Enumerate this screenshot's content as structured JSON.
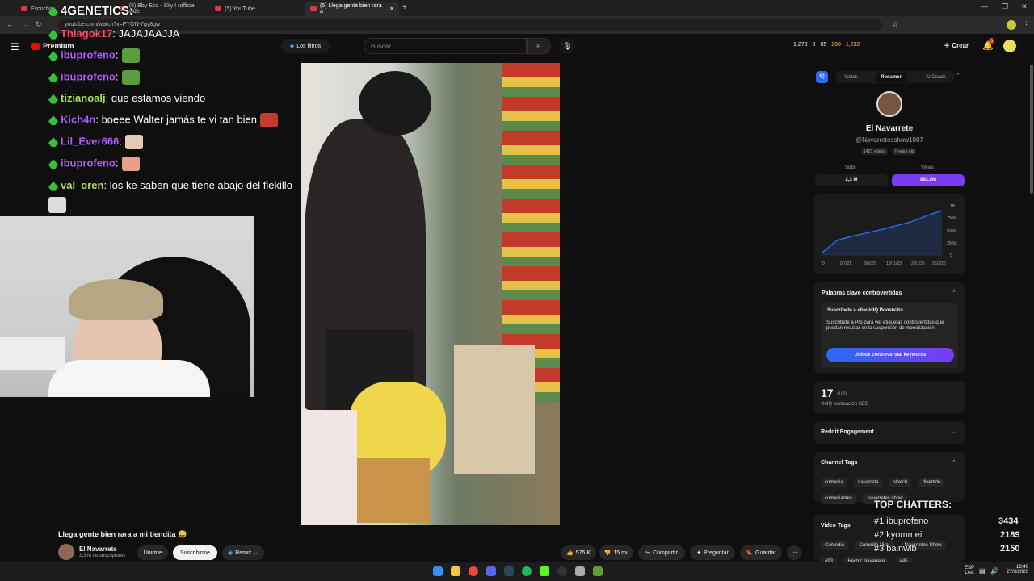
{
  "browser": {
    "tabs": [
      {
        "label": "Escucha"
      },
      {
        "label": "(5) Bby Eco - Sky I (official vide"
      },
      {
        "label": "(5) YouTube"
      },
      {
        "label": "(5) Llega gente bien rara a"
      }
    ],
    "url": "youtube.com/watch?v=PYON-7gy8gw"
  },
  "yt": {
    "logo": "Premium",
    "filters_label": "Los filtros",
    "search_placeholder": "Buscar",
    "stats": [
      "1,273",
      "0",
      "65",
      "260",
      "1,232"
    ],
    "create_label": "Crear",
    "notif_count": "5"
  },
  "chat": [
    {
      "user": "Thiagok17",
      "msg": ": JAJAJAAJJA",
      "color": "#ff4a6e"
    },
    {
      "user": "ibuprofeno",
      "msg": ":",
      "color": "#b05cff",
      "emote": "#5a9e3b"
    },
    {
      "user": "ibuprofeno",
      "msg": ":",
      "color": "#b05cff",
      "emote": "#5a9e3b"
    },
    {
      "user": "tizianoalj",
      "msg": ": que estamos viendo",
      "color": "#a8e35a"
    },
    {
      "user": "Kich4n",
      "msg": ": boeee Walter jamás te vi tan bien",
      "color": "#b05cff",
      "emote": "#c43a2a"
    },
    {
      "user": "Lil_Ever666",
      "msg": ":",
      "color": "#b05cff",
      "emote": "#e7c9b8"
    },
    {
      "user": "ibuprofeno",
      "msg": ":",
      "color": "#b05cff",
      "emote": "#e8a08a"
    },
    {
      "user": "val_oren",
      "msg": ": los ke saben que tiene abajo del flekillo",
      "color": "#a8e35a"
    }
  ],
  "overlay_title": "4GENETICS:",
  "video": {
    "title": "Llega gente bien rara a mi tiendita 😅",
    "channel": "El Navarrete",
    "subs": "2,3 M de suscriptores",
    "join": "Unirme",
    "subscribe": "Suscribirme",
    "remix": "Remix",
    "likes": "575 K",
    "dislikes": "15 mil",
    "share": "Compartir",
    "ask": "Preguntar",
    "save": "Guardar"
  },
  "panel": {
    "tabs": [
      "Vistas",
      "Resumen",
      "AI Coach"
    ],
    "channel_name": "El Navarrete",
    "handle": "@Navarretesshow1007",
    "videos": "1423 videos",
    "age": "7 years old",
    "subs_label": "Subs",
    "views_label": "Views",
    "subs_value": "2,3 M",
    "views_value": "892.8M",
    "y_ticks": [
      "1B",
      "750M",
      "500M",
      "250M",
      "0"
    ],
    "x_ticks": [
      "0",
      "9/7/21",
      "9/9/22",
      "10/11/23",
      "23/1/25",
      "26/3/26"
    ],
    "controversial_title": "Palabras clave controvertidas",
    "boost_title": "Suscríbete a <b>vidIQ Boost</b>",
    "boost_text": "Suscríbete a Pro para ver etiquetas controvertidas que puedan resultar en la suspensión de monetización",
    "unlock_label": "Unlock controversial keywords",
    "seo_score": "17",
    "seo_max": "/100",
    "seo_label": "vidIQ puntuación SEO",
    "reddit_label": "Reddit Engagement",
    "channel_tags_label": "Channel Tags",
    "channel_tags": [
      "comedia",
      "navarreta",
      "sketch",
      "divertido",
      "comediantes",
      "navarretes show"
    ],
    "video_tags_label": "Video Tags",
    "video_tags": [
      "Comedia",
      "Comedia Viral",
      "Navarretes Show",
      "#93",
      "Hector Navarrete",
      "#45"
    ]
  },
  "top_chatters": {
    "title": "TOP CHATTERS:",
    "rows": [
      {
        "name": "#1 ibuprofeno",
        "count": "3434"
      },
      {
        "name": "#2 kyommeii",
        "count": "2189"
      },
      {
        "name": "#3 bainwlb",
        "count": "2150"
      }
    ]
  },
  "taskbar": {
    "lang": "ESP",
    "lang2": "LAA",
    "time": "18:40",
    "date": "27/3/2026"
  },
  "chart_trend": [
    0.05,
    0.3,
    0.38,
    0.45,
    0.52,
    0.6,
    0.68,
    0.8,
    0.9
  ]
}
